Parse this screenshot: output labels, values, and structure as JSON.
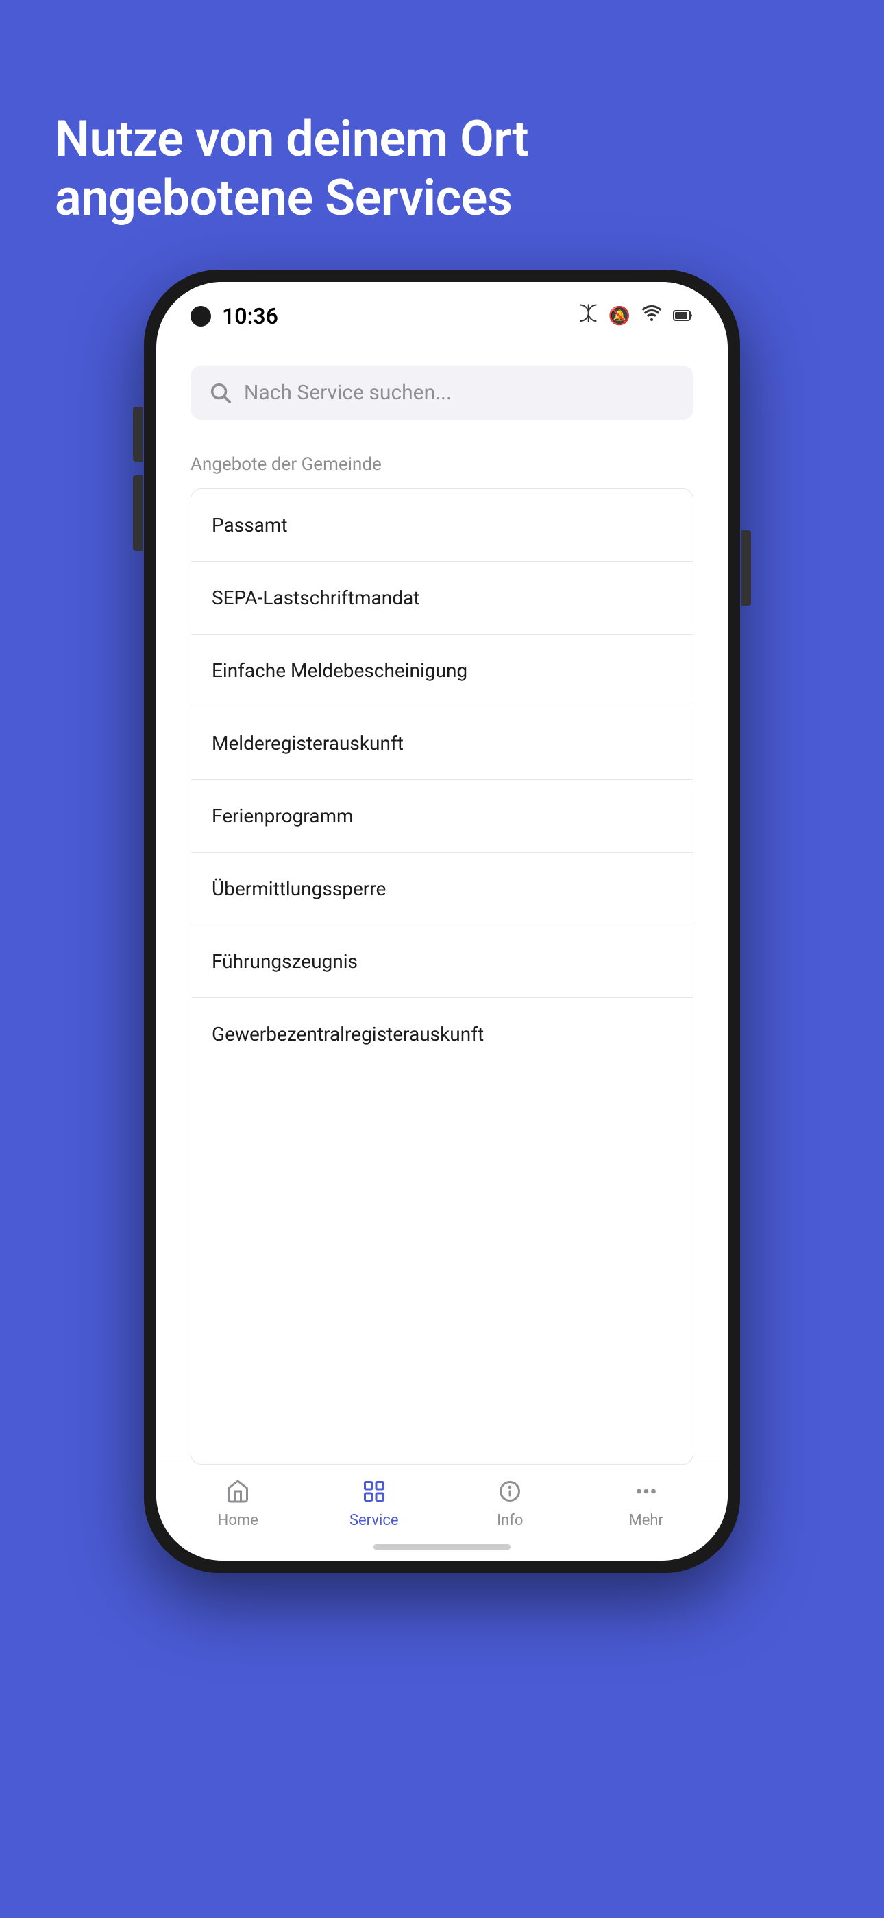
{
  "background_color": "#4A5BD4",
  "headline": {
    "line1": "Nutze von deinem Ort",
    "line2": "angebotene Services"
  },
  "phone": {
    "status_bar": {
      "time": "10:36",
      "icons": [
        "bluetooth",
        "bell-off",
        "wifi",
        "battery"
      ]
    },
    "search": {
      "placeholder": "Nach Service suchen..."
    },
    "section_label": "Angebote der Gemeinde",
    "services": [
      {
        "id": 1,
        "label": "Passamt"
      },
      {
        "id": 2,
        "label": "SEPA-Lastschriftmandat"
      },
      {
        "id": 3,
        "label": "Einfache Meldebescheinigung"
      },
      {
        "id": 4,
        "label": "Melderegisterauskunft"
      },
      {
        "id": 5,
        "label": "Ferienprogramm"
      },
      {
        "id": 6,
        "label": "Übermittlungssperre"
      },
      {
        "id": 7,
        "label": "Führungszeugnis"
      },
      {
        "id": 8,
        "label": "Gewerbezentralregisterauskunft"
      }
    ],
    "bottom_nav": [
      {
        "id": "home",
        "label": "Home",
        "active": false
      },
      {
        "id": "service",
        "label": "Service",
        "active": true
      },
      {
        "id": "info",
        "label": "Info",
        "active": false
      },
      {
        "id": "mehr",
        "label": "Mehr",
        "active": false
      }
    ]
  }
}
